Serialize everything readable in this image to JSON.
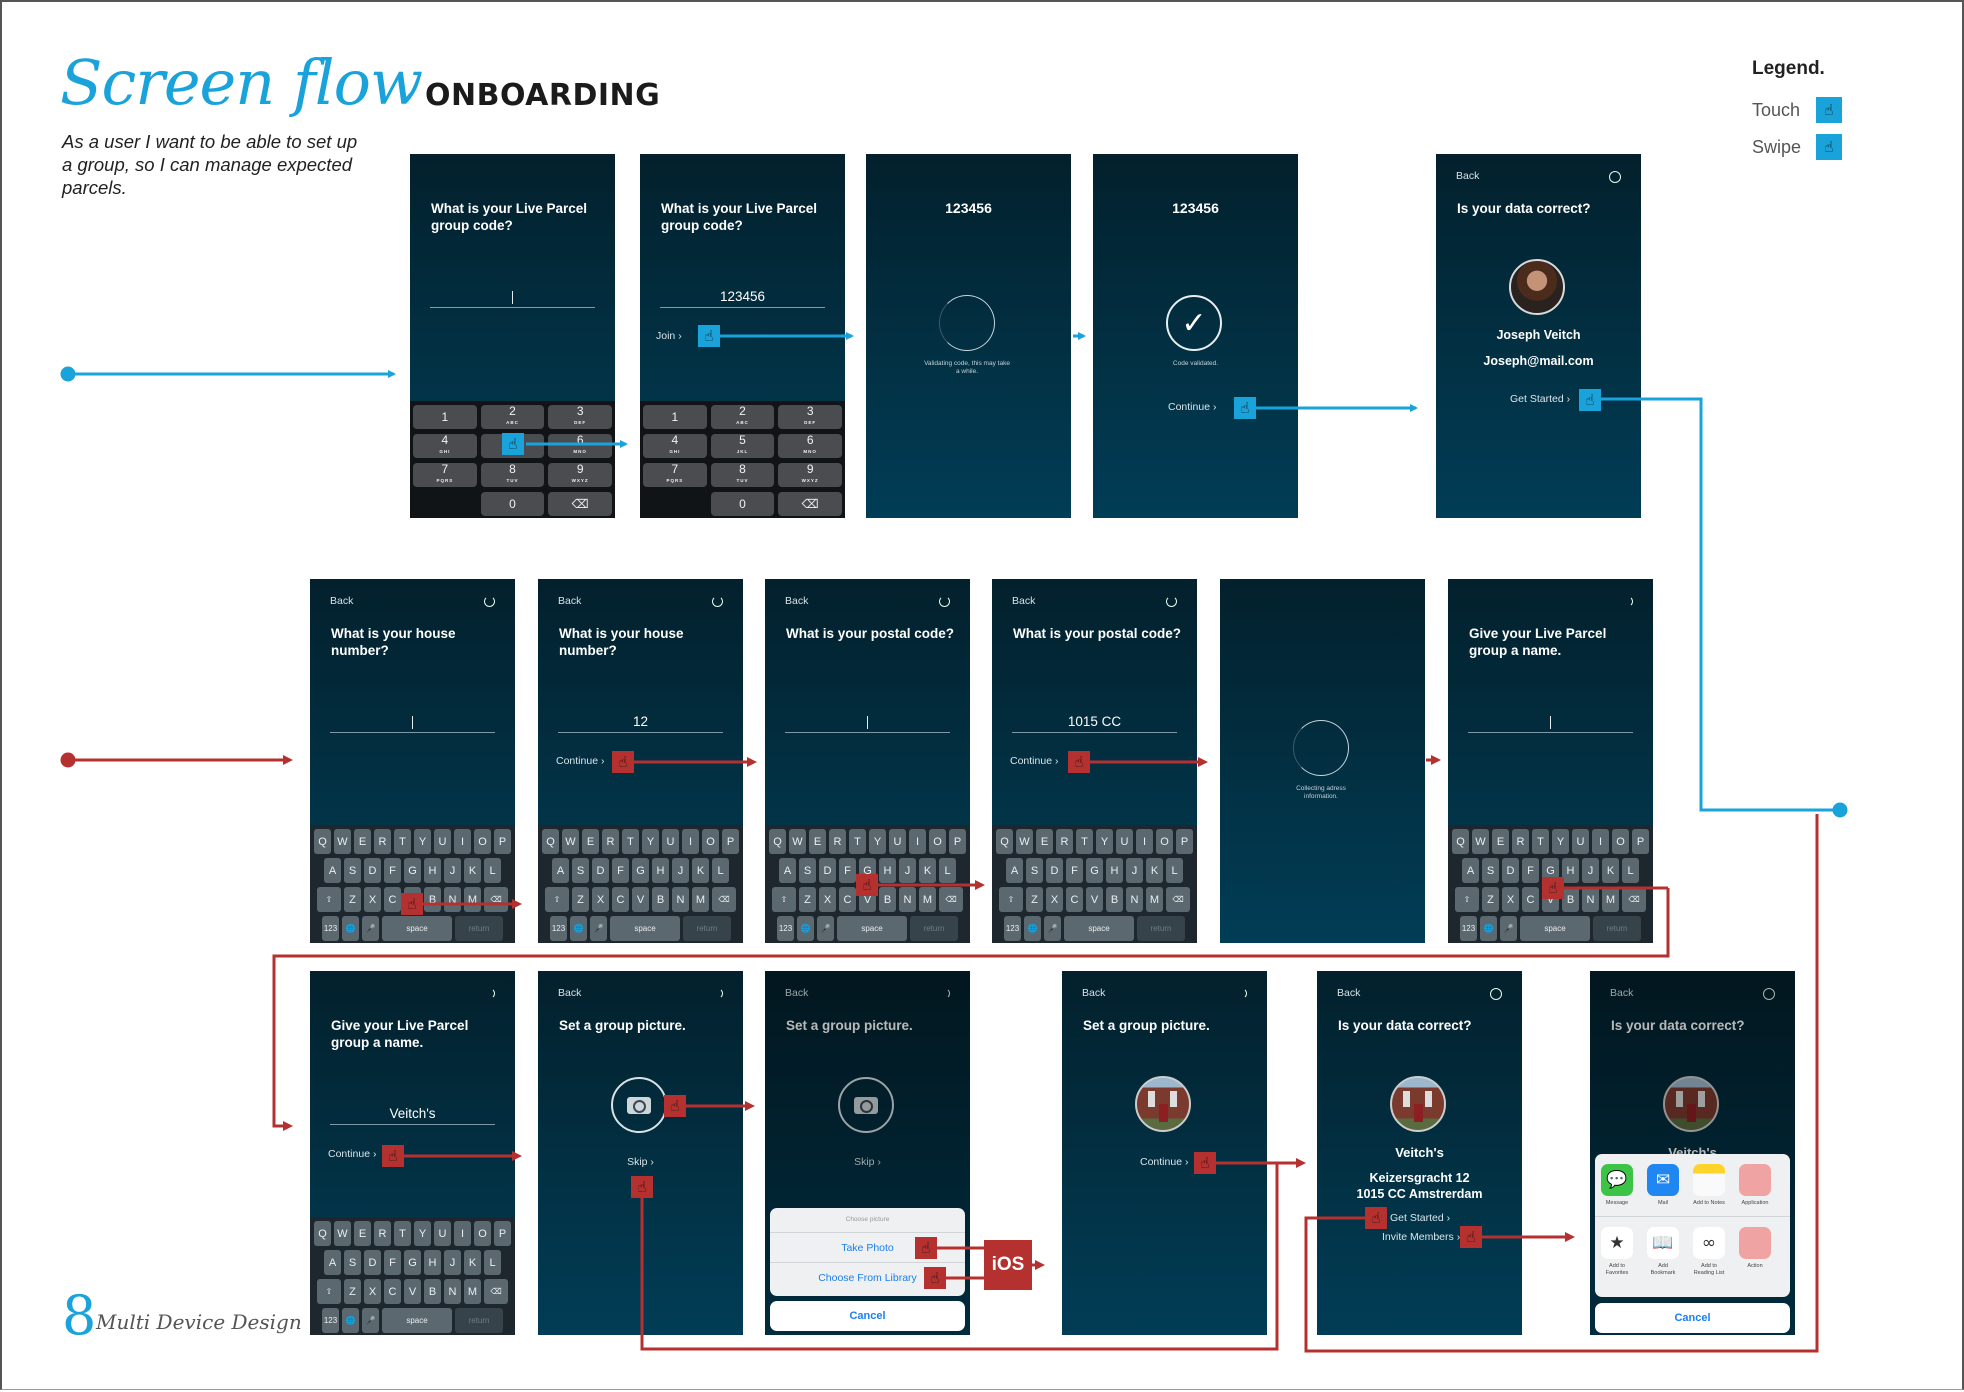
{
  "header": {
    "script_title": "Screen flow",
    "bold_title": "ONBOARDING",
    "description": "As a user I want to be able to set up a group, so I can manage expected parcels."
  },
  "legend": {
    "title": "Legend.",
    "touch": "Touch",
    "swipe": "Swipe",
    "touch_icon": "hand-pointer-icon",
    "swipe_icon": "hand-swipe-icon"
  },
  "colors": {
    "primary_flow": "#1aa3db",
    "secondary_flow": "#b5312f",
    "screen_top": "#03202c",
    "screen_bottom": "#013d56"
  },
  "footer": {
    "page_number": "8",
    "label": "Multi Device Design"
  },
  "common": {
    "back": "Back",
    "continue": "Continue",
    "chevron": "›",
    "cursor": "|"
  },
  "keypad": [
    {
      "d": "1",
      "l": ""
    },
    {
      "d": "2",
      "l": "ABC"
    },
    {
      "d": "3",
      "l": "DEF"
    },
    {
      "d": "4",
      "l": "GHI"
    },
    {
      "d": "5",
      "l": "JKL"
    },
    {
      "d": "6",
      "l": "MNO"
    },
    {
      "d": "7",
      "l": "PQRS"
    },
    {
      "d": "8",
      "l": "TUV"
    },
    {
      "d": "9",
      "l": "WXYZ"
    },
    {
      "d": "",
      "l": ""
    },
    {
      "d": "0",
      "l": ""
    },
    {
      "d": "⌫",
      "l": ""
    }
  ],
  "keyboard": {
    "rows": [
      [
        "Q",
        "W",
        "E",
        "R",
        "T",
        "Y",
        "U",
        "I",
        "O",
        "P"
      ],
      [
        "A",
        "S",
        "D",
        "F",
        "G",
        "H",
        "J",
        "K",
        "L"
      ],
      [
        "⇧",
        "Z",
        "X",
        "C",
        "V",
        "B",
        "N",
        "M",
        "⌫"
      ]
    ],
    "bottom": [
      "123",
      "🌐",
      "🎤",
      "space",
      "return"
    ]
  },
  "screens": {
    "code_empty": {
      "title": "What is your Live Parcel group code?"
    },
    "code_filled": {
      "title": "What is your Live Parcel group code?",
      "value": "123456",
      "action": "Join"
    },
    "validating": {
      "code": "123456",
      "caption": "Validating code, this may take a while."
    },
    "validated": {
      "code": "123456",
      "caption": "Code validated.",
      "action": "Continue"
    },
    "user_check": {
      "title": "Is your data correct?",
      "name": "Joseph Veitch",
      "email": "Joseph@mail.com",
      "action": "Get Started"
    },
    "house_empty": {
      "title": "What is your house number?"
    },
    "house_filled": {
      "title": "What is your house number?",
      "value": "12"
    },
    "postal_empty": {
      "title": "What is your postal code?"
    },
    "postal_filled": {
      "title": "What is your postal code?",
      "value": "1015 CC"
    },
    "collecting": {
      "caption": "Collecting adress information."
    },
    "name_empty": {
      "title": "Give your Live Parcel group a name."
    },
    "name_filled": {
      "title": "Give your Live Parcel group a name.",
      "value": "Veitch's"
    },
    "picture": {
      "title": "Set a group picture.",
      "skip": "Skip"
    },
    "picture_sheet": {
      "title": "Set a group picture.",
      "skip": "Skip",
      "sheet_title": "Choose picture",
      "take_photo": "Take Photo",
      "library": "Choose From Library",
      "cancel": "Cancel"
    },
    "picture_set": {
      "title": "Set a group picture."
    },
    "group_check": {
      "title": "Is your data correct?",
      "group": "Veitch's",
      "street": "Keizersgracht 12",
      "city": "1015 CC Amstrerdam",
      "get_started": "Get Started",
      "invite": "Invite Members"
    },
    "share": {
      "title": "Is your data correct?",
      "group": "Veitch's",
      "row1": [
        {
          "label": "Message",
          "icon": "message-icon"
        },
        {
          "label": "Mail",
          "icon": "mail-icon"
        },
        {
          "label": "Add to Notes",
          "icon": "notes-icon"
        },
        {
          "label": "Application",
          "icon": "app-icon"
        }
      ],
      "row2": [
        {
          "label": "Add to Favorites",
          "icon": "star-icon"
        },
        {
          "label": "Add Bookmark",
          "icon": "book-icon"
        },
        {
          "label": "Add to Reading List",
          "icon": "glasses-icon"
        },
        {
          "label": "Action",
          "icon": "action-icon"
        }
      ],
      "cancel": "Cancel"
    }
  },
  "ios_label": "iOS"
}
